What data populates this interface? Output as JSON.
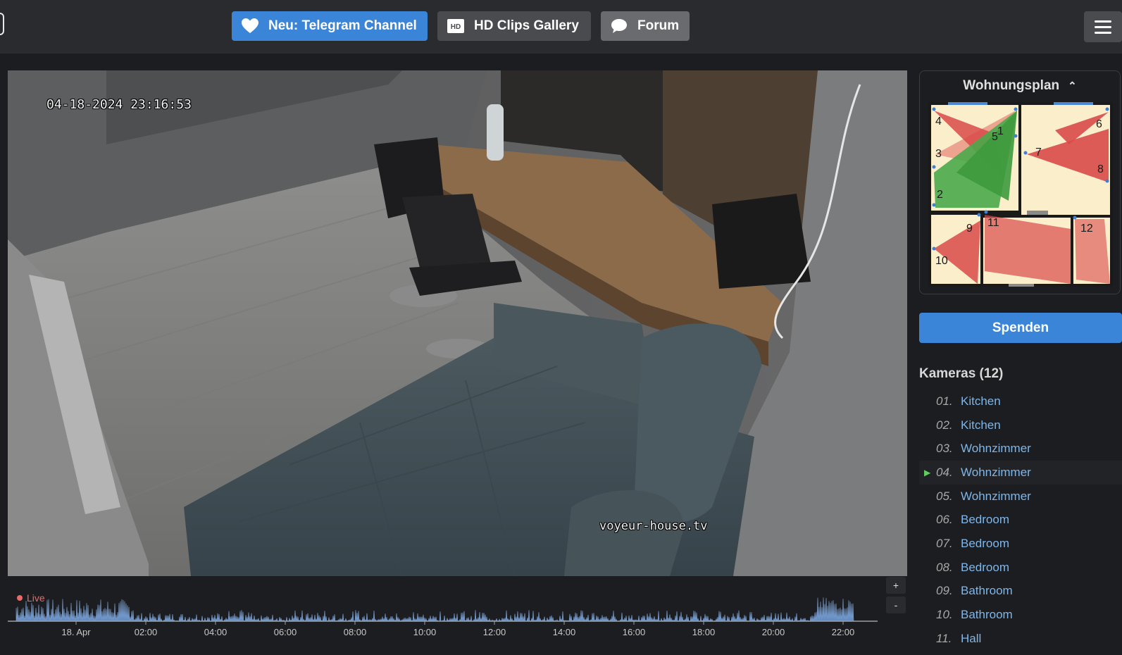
{
  "header": {
    "buttons": [
      {
        "label": "Neu: Telegram Channel",
        "icon": "heart-icon"
      },
      {
        "label": "HD Clips Gallery",
        "icon": "hd-icon",
        "icon_text": "HD"
      },
      {
        "label": "Forum",
        "icon": "chat-bubble-icon"
      }
    ],
    "menu_icon": "hamburger-menu-icon"
  },
  "video": {
    "timestamp": "04-18-2024 23:16:53",
    "watermark": "voyeur-house.tv"
  },
  "timeline": {
    "live_label": "Live",
    "ticks": [
      "18. Apr",
      "02:00",
      "04:00",
      "06:00",
      "08:00",
      "10:00",
      "12:00",
      "14:00",
      "16:00",
      "18:00",
      "20:00",
      "22:00"
    ],
    "zoom_in": "+",
    "zoom_out": "-"
  },
  "floorplan": {
    "title": "Wohnungsplan",
    "chevron": "^",
    "cameras": [
      "1",
      "2",
      "3",
      "4",
      "5",
      "6",
      "7",
      "8",
      "9",
      "10",
      "11",
      "12"
    ]
  },
  "donate_label": "Spenden",
  "cameras": {
    "title": "Kameras (12)",
    "items": [
      {
        "num": "01.",
        "name": "Kitchen"
      },
      {
        "num": "02.",
        "name": "Kitchen"
      },
      {
        "num": "03.",
        "name": "Wohnzimmer"
      },
      {
        "num": "04.",
        "name": "Wohnzimmer",
        "active": true
      },
      {
        "num": "05.",
        "name": "Wohnzimmer"
      },
      {
        "num": "06.",
        "name": "Bedroom"
      },
      {
        "num": "07.",
        "name": "Bedroom"
      },
      {
        "num": "08.",
        "name": "Bedroom"
      },
      {
        "num": "09.",
        "name": "Bathroom"
      },
      {
        "num": "10.",
        "name": "Bathroom"
      },
      {
        "num": "11.",
        "name": "Hall"
      }
    ]
  },
  "colors": {
    "accent": "#3a85d8",
    "live": "#e76a6a",
    "active_marker": "#5fcf5f",
    "link": "#7eb6ea"
  }
}
